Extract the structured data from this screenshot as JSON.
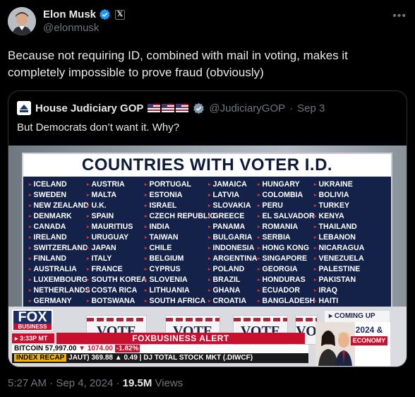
{
  "author": {
    "name": "Elon Musk",
    "handle": "@elonmusk",
    "badge": "𝕏"
  },
  "tweet": {
    "text": "Because not requiring ID, combined with mail in voting, makes it completely impossible to prove fraud (obviously)"
  },
  "quote": {
    "name": "House Judiciary GOP",
    "handle": "@JudiciaryGOP",
    "date": "Sep 3",
    "text": "But Democrats don’t want it. Why?",
    "image": {
      "board_title": "COUNTRIES WITH VOTER I.D.",
      "columns": [
        [
          "ICELAND",
          "SWEDEN",
          "NEW ZEALAND",
          "DENMARK",
          "CANADA",
          "IRELAND",
          "SWITZERLAND",
          "FINLAND",
          "AUSTRALIA",
          "LUXEMBOURG",
          "NETHERLANDS",
          "GERMANY"
        ],
        [
          "AUSTRIA",
          "MALTA",
          "U.K.",
          "SPAIN",
          "MAURITIUS",
          "URUGUAY",
          "JAPAN",
          "ITALY",
          "FRANCE",
          "SOUTH KOREA",
          "COSTA RICA",
          "BOTSWANA"
        ],
        [
          "PORTUGAL",
          "ESTONIA",
          "ISRAEL",
          "CZECH REPUBLIC",
          "INDIA",
          "TAIWAN",
          "CHILE",
          "BELGIUM",
          "CYPRUS",
          "SLOVENIA",
          "LITHUANIA",
          "SOUTH AFRICA"
        ],
        [
          "JAMAICA",
          "LATVIA",
          "SLOVAKIA",
          "GREECE",
          "PANAMA",
          "BULGARIA",
          "INDONESIA",
          "ARGENTINA",
          "POLAND",
          "BRAZIL",
          "GHANA",
          "CROATIA"
        ],
        [
          "HUNGARY",
          "COLOMBIA",
          "PERU",
          "EL SALVADOR",
          "ROMANIA",
          "SERBIA",
          "HONG KONG",
          "SINGAPORE",
          "GEORGIA",
          "HONDURAS",
          "ECUADOR",
          "BANGLADESH"
        ],
        [
          "UKRAINE",
          "BOLIVIA",
          "TURKEY",
          "KENYA",
          "THAILAND",
          "LEBANON",
          "NICARAGUA",
          "VENEZUELA",
          "PALESTINE",
          "PAKISTAN",
          "IRAQ",
          "HAITI"
        ]
      ],
      "vote_signs": [
        "VOTE",
        "VOTE",
        "VOTE",
        "VO"
      ],
      "network": "FOX",
      "network_sub": "BUSINESS",
      "time": "3:33P MT",
      "alert": "FOXBUSINESS ALERT",
      "ticker_line1": {
        "label": "BITCOIN",
        "price": "57,997.00",
        "change": "▼ 1074.00",
        "pct": "-1.82%"
      },
      "ticker_line2": {
        "tag": "INDEX RECAP",
        "symbol": "JAUT)",
        "value1": "369.88",
        "value2": "0.49",
        "rest": "DJ TOTAL STOCK MKT (.DIWCF)"
      },
      "coming_up": "COMING UP",
      "promo_year": "2024 &",
      "promo_eco": "ECONOMY"
    }
  },
  "footer": {
    "time": "5:27 AM",
    "sep": "·",
    "date": "Sep 4, 2024",
    "views_count": "19.5M",
    "views_label": "Views"
  },
  "colors": {
    "background": "#000000",
    "text": "#e7e9ea",
    "muted": "#71767b",
    "verified": "#1d9bf0",
    "board": "#14224a",
    "fox_red": "#c8102e"
  }
}
